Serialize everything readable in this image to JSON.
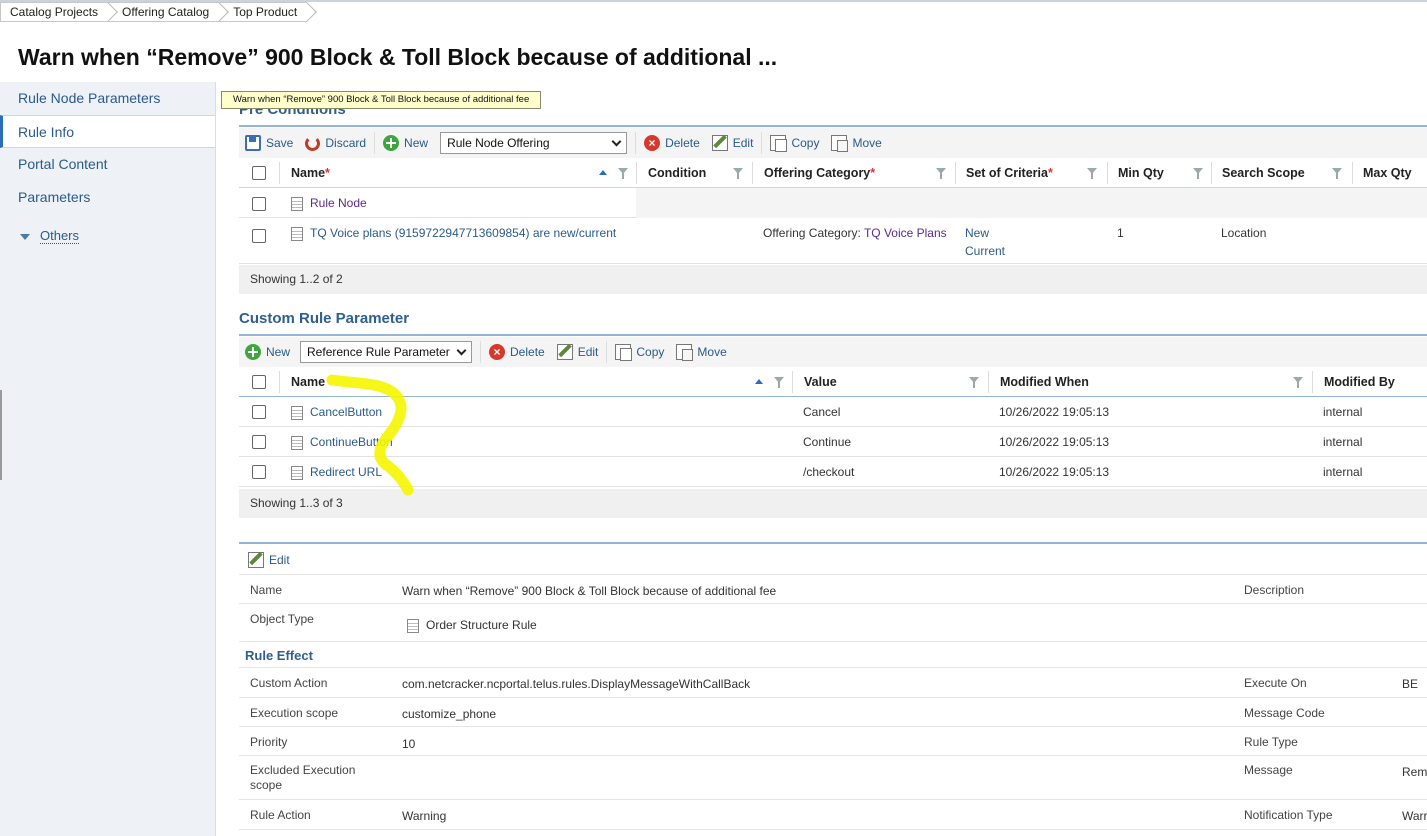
{
  "breadcrumb": [
    "Catalog Projects",
    "Offering Catalog",
    "Top Product"
  ],
  "page_title": "Warn when “Remove” 900 Block & Toll Block because of additional ...",
  "tooltip": "Warn when “Remove” 900 Block & Toll Block because of additional fee",
  "sidebar": {
    "items": [
      {
        "label": "Rule Node Parameters"
      },
      {
        "label": "Rule Info",
        "active": true
      },
      {
        "label": "Portal Content"
      },
      {
        "label": "Parameters"
      }
    ],
    "others": "Others"
  },
  "pre_conditions": {
    "title": "Pre Conditions",
    "toolbar": {
      "save": "Save",
      "discard": "Discard",
      "new": "New",
      "select": "Rule Node Offering",
      "delete": "Delete",
      "edit": "Edit",
      "copy": "Copy",
      "move": "Move"
    },
    "columns": [
      "Name",
      "Condition",
      "Offering Category",
      "Set of Criteria",
      "Min Qty",
      "Search Scope",
      "Max Qty"
    ],
    "rows": [
      {
        "name": "Rule Node",
        "condition": "",
        "offering_category_prefix": "",
        "offering_category_link": "",
        "criteria": [
          "",
          ""
        ],
        "min_qty": "",
        "scope": ""
      },
      {
        "name": "TQ Voice plans (915972294771​3609854) are new/current",
        "condition": "",
        "offering_category_prefix": "Offering Category: ",
        "offering_category_link": "TQ Voice Plans",
        "criteria": [
          "New",
          "Current"
        ],
        "min_qty": "1",
        "scope": "Location"
      }
    ],
    "footer": "Showing 1..2 of 2"
  },
  "custom_rule": {
    "title": "Custom Rule Parameter",
    "toolbar": {
      "new": "New",
      "select": "Reference Rule Parameter",
      "delete": "Delete",
      "edit": "Edit",
      "copy": "Copy",
      "move": "Move"
    },
    "columns": [
      "Name",
      "Value",
      "Modified When",
      "Modified By"
    ],
    "rows": [
      {
        "name": "CancelButton",
        "value": "Cancel",
        "when": "10/26/2022 19:05:13",
        "by": "internal"
      },
      {
        "name": "ContinueButton",
        "value": "Continue",
        "when": "10/26/2022 19:05:13",
        "by": "internal"
      },
      {
        "name": "Redirect URL",
        "value": "/checkout",
        "when": "10/26/2022 19:05:13",
        "by": "internal"
      }
    ],
    "footer": "Showing 1..3 of 3"
  },
  "details": {
    "edit": "Edit",
    "name_label": "Name",
    "name_value": "Warn when “Remove” 900 Block & Toll Block because of additional fee",
    "description_label": "Description",
    "object_type_label": "Object Type",
    "object_type_value": "Order Structure Rule",
    "rule_effect": "Rule Effect",
    "custom_action_label": "Custom Action",
    "custom_action_value": "com.netcracker.ncportal.telus.rules.DisplayMessageWithCallBack",
    "execute_on_label": "Execute On",
    "execute_on_value": "BE",
    "execution_scope_label": "Execution scope",
    "execution_scope_value": "customize_phone",
    "message_code_label": "Message Code",
    "priority_label": "Priority",
    "priority_value": "10",
    "rule_type_label": "Rule Type",
    "excluded_label_1": "Excluded Execution",
    "excluded_label_2": "scope",
    "message_label": "Message",
    "message_value": "Rem",
    "rule_action_label": "Rule Action",
    "rule_action_value": "Warning",
    "notification_type_label": "Notification Type",
    "notification_type_value": "Warr"
  },
  "colors": {
    "accent": "#2e5f8e",
    "highlight": "#f5f500",
    "link": "#2a5a8a"
  }
}
